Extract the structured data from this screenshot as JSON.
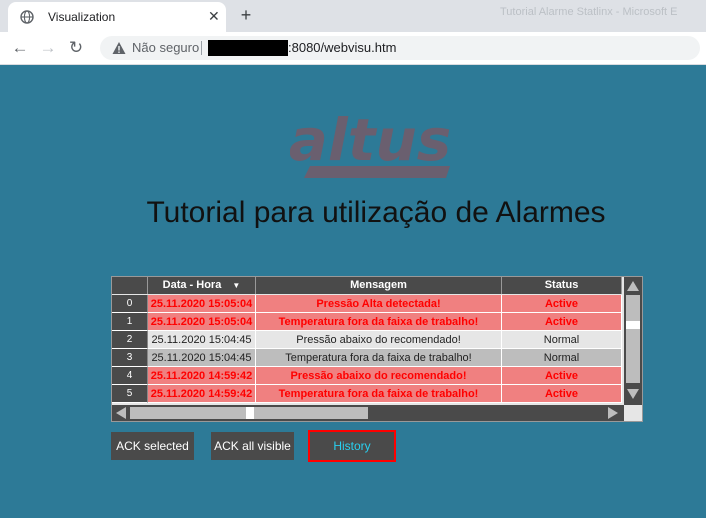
{
  "browser": {
    "tab_title": "Visualization",
    "tab_close": "✕",
    "new_tab": "+",
    "faded_window_title": "Tutorial Alarme Statlinx - Microsoft E",
    "back": "←",
    "forward": "→",
    "reload": "↻",
    "security_label": "Não seguro",
    "url": ":8080/webvisu.htm"
  },
  "page": {
    "logo_text": "altus",
    "title": "Tutorial para utilização de Alarmes"
  },
  "table": {
    "headers": [
      "",
      "Data - Hora",
      "Mensagem",
      "Status"
    ],
    "sort_indicator": "▼",
    "rows": [
      {
        "index": "0",
        "datetime": "25.11.2020 15:05:04",
        "message": "Pressão Alta detectada!",
        "status": "Active",
        "state": "active"
      },
      {
        "index": "1",
        "datetime": "25.11.2020 15:05:04",
        "message": "Temperatura fora da faixa de trabalho!",
        "status": "Active",
        "state": "active"
      },
      {
        "index": "2",
        "datetime": "25.11.2020 15:04:45",
        "message": "Pressão abaixo do recomendado!",
        "status": "Normal",
        "state": "normal"
      },
      {
        "index": "3",
        "datetime": "25.11.2020 15:04:45",
        "message": "Temperatura fora da faixa de trabalho!",
        "status": "Normal",
        "state": "normal"
      },
      {
        "index": "4",
        "datetime": "25.11.2020 14:59:42",
        "message": "Pressão abaixo do recomendado!",
        "status": "Active",
        "state": "active"
      },
      {
        "index": "5",
        "datetime": "25.11.2020 14:59:42",
        "message": "Temperatura fora da faixa de trabalho!",
        "status": "Active",
        "state": "active"
      }
    ]
  },
  "buttons": {
    "ack_selected": "ACK selected",
    "ack_all_visible": "ACK all visible",
    "history": "History"
  },
  "colors": {
    "background": "#2d7a97",
    "active_row": "#f08080",
    "active_text": "#ff0000",
    "history_border": "#ff0000",
    "history_text": "#28d0f0"
  }
}
